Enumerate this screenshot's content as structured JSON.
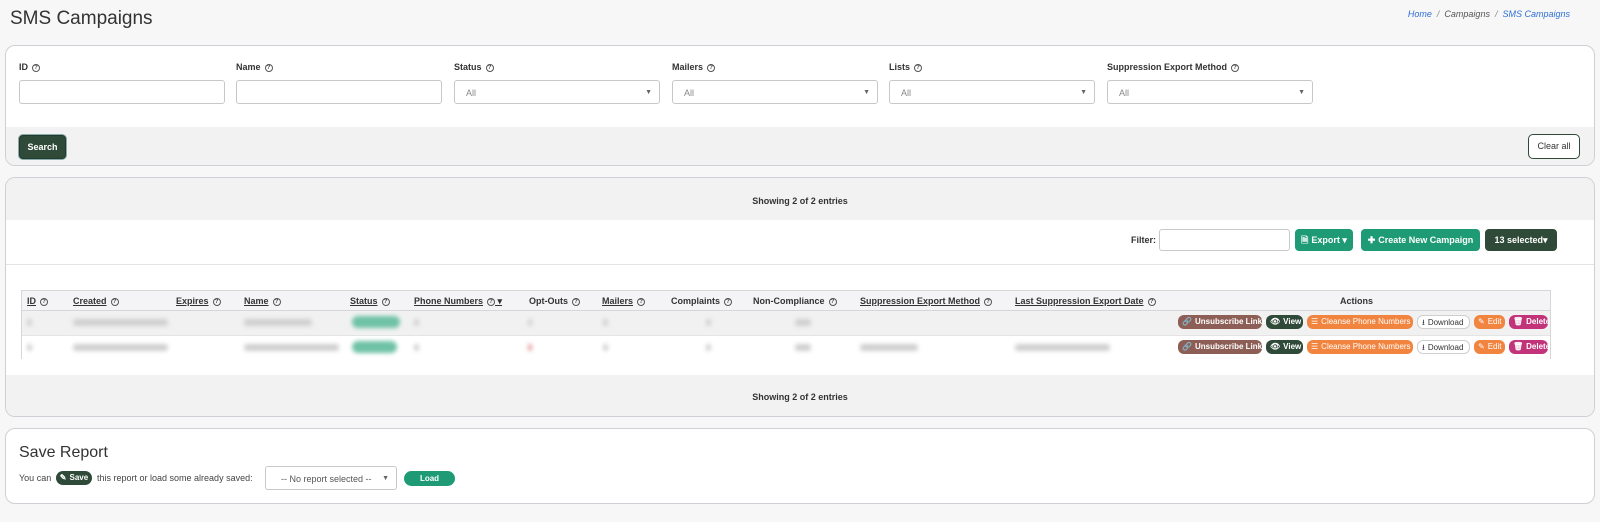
{
  "page": {
    "title": "SMS Campaigns"
  },
  "breadcrumb": {
    "home": "Home",
    "sep": "/",
    "campaigns": "Campaigns",
    "current": "SMS Campaigns"
  },
  "filters": {
    "id_label": "ID",
    "name_label": "Name",
    "status_label": "Status",
    "mailers_label": "Mailers",
    "lists_label": "Lists",
    "suppression_label": "Suppression Export Method",
    "status_value": "All",
    "mailers_value": "All",
    "lists_value": "All",
    "suppression_value": "All",
    "search_button": "Search",
    "clear_button": "Clear all"
  },
  "results": {
    "showing_top": "Showing 2 of 2 entries",
    "showing_bottom": "Showing 2 of 2 entries",
    "filter_label": "Filter:",
    "export_button": "Export",
    "create_button": "Create New Campaign",
    "selected_button": "13 selected"
  },
  "table": {
    "columns": [
      "ID",
      "Created",
      "Expires",
      "Name",
      "Status",
      "Phone Numbers",
      "Opt-Outs",
      "Mailers",
      "Complaints",
      "Non-Compliance",
      "Suppression Export Method",
      "Last Suppression Export Date",
      "Actions"
    ],
    "actions": {
      "unsubscribe": "Unsubscribe Links",
      "view": "View",
      "cleanse": "Cleanse Phone Numbers",
      "download": "Download",
      "edit": "Edit",
      "delete": "Delete"
    }
  },
  "save_report": {
    "title": "Save Report",
    "you_can": "You can",
    "save_chip": "Save",
    "rest": "this report or load some already saved:",
    "select_value": "-- No report selected --",
    "load_button": "Load"
  }
}
